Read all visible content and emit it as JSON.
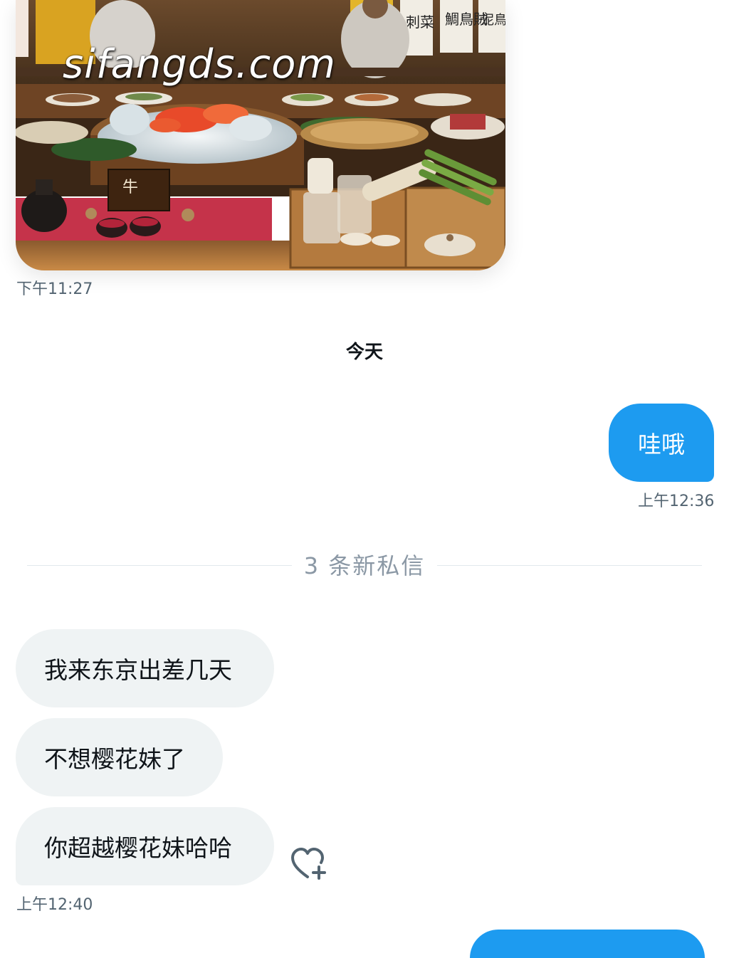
{
  "thread": {
    "photo": {
      "watermark": "sifangds.com",
      "sign_left": "牛",
      "sign_right_1": "刺菜",
      "sign_right_2": "鯛鳥賊",
      "sign_right_3": "泥鳥賊",
      "time": "下午11:27"
    },
    "day_divider": "今天",
    "sent_message": {
      "text": "哇哦",
      "time": "上午12:36"
    },
    "new_messages_label": "3 条新私信",
    "received_messages": [
      {
        "text": "我来东京出差几天"
      },
      {
        "text": "不想樱花妹了"
      },
      {
        "text": "你超越樱花妹哈哈"
      }
    ],
    "received_time": "上午12:40",
    "react_icon": "heart-plus-icon"
  },
  "colors": {
    "sent_bubble": "#1d9bf0",
    "received_bubble": "#eff3f4",
    "timestamp": "#536471",
    "divider_text": "#8b98a5"
  }
}
